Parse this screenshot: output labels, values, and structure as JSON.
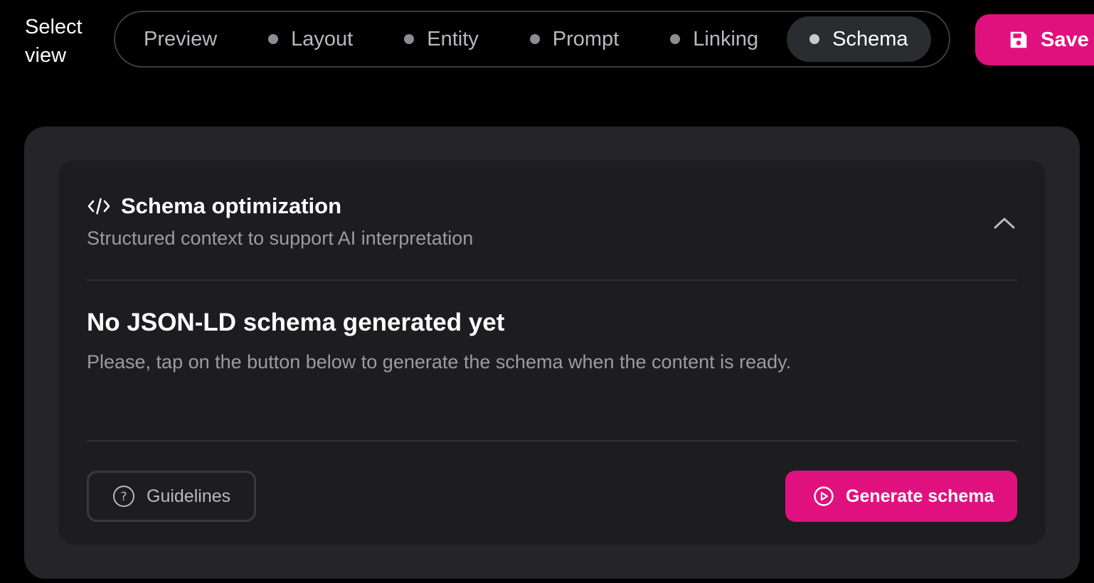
{
  "top_bar": {
    "select_view_label": "Select view",
    "tabs": [
      {
        "label": "Preview",
        "active": false
      },
      {
        "label": "Layout",
        "active": false
      },
      {
        "label": "Entity",
        "active": false
      },
      {
        "label": "Prompt",
        "active": false
      },
      {
        "label": "Linking",
        "active": false
      },
      {
        "label": "Schema",
        "active": true
      }
    ],
    "save_label": "Save"
  },
  "schema_card": {
    "icon": "code-icon",
    "title": "Schema optimization",
    "subtitle": "Structured context to support AI interpretation",
    "toggle_icon": "chevron-up-icon",
    "empty_title": "No JSON-LD schema generated yet",
    "empty_text": "Please, tap on the button below to generate the schema when the content is ready.",
    "guidelines_label": "Guidelines",
    "guidelines_icon": "question-circle-icon",
    "generate_label": "Generate schema",
    "generate_icon": "play-circle-icon"
  },
  "colors": {
    "accent": "#e0117f",
    "background": "#000000",
    "panel": "#252527",
    "card": "#1d1d1f",
    "muted_text": "#9b9ba0"
  }
}
